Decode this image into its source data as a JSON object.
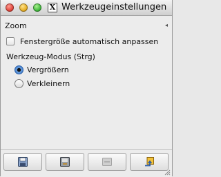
{
  "window": {
    "title": "Werkzeugeinstellungen",
    "x_icon_glyph": "X"
  },
  "section": {
    "title": "Zoom",
    "collapse_arrow": "◂"
  },
  "options": {
    "auto_resize_label": "Fenstergröße automatisch anpassen",
    "auto_resize_checked": false,
    "mode_group_title": "Werkzeug-Modus (Strg)",
    "modes": [
      {
        "label": "Vergrößern",
        "selected": true
      },
      {
        "label": "Verkleinern",
        "selected": false
      }
    ]
  },
  "toolbar": {
    "buttons": [
      {
        "icon": "save-icon"
      },
      {
        "icon": "restore-icon"
      },
      {
        "icon": "delete-icon"
      },
      {
        "icon": "reset-icon"
      }
    ]
  },
  "colors": {
    "accent": "#2f6ec0",
    "close": "#e0443a",
    "minimize": "#e6ad22",
    "zoom": "#3fb83b"
  }
}
